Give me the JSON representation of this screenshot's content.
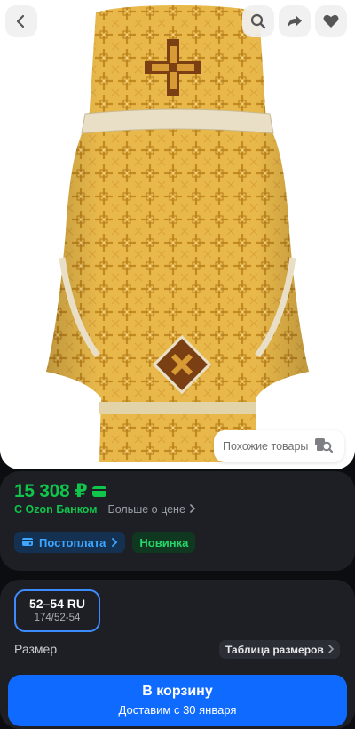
{
  "hero": {
    "similar_label": "Похожие товары"
  },
  "price_card": {
    "price": "15 308 ₽",
    "bank_label": "С Ozon Банком",
    "more_label": "Больше о цене",
    "badges": [
      {
        "label": "Постоплата"
      },
      {
        "label": "Новинка"
      }
    ]
  },
  "size_card": {
    "selected_size": "52–54 RU",
    "selected_size_sub": "174/52-54",
    "label": "Размер",
    "table_label": "Таблица размеров"
  },
  "cart": {
    "title": "В корзину",
    "subtitle": "Доставим с 30 января"
  },
  "colors": {
    "accent_blue": "#0f6bff",
    "price_green": "#10c44c",
    "card_bg": "#1d1f24"
  },
  "icons": [
    "chevron-left-icon",
    "search-icon",
    "share-icon",
    "heart-icon",
    "similar-search-icon",
    "card-icon",
    "chevron-right-icon",
    "wallet-icon"
  ]
}
